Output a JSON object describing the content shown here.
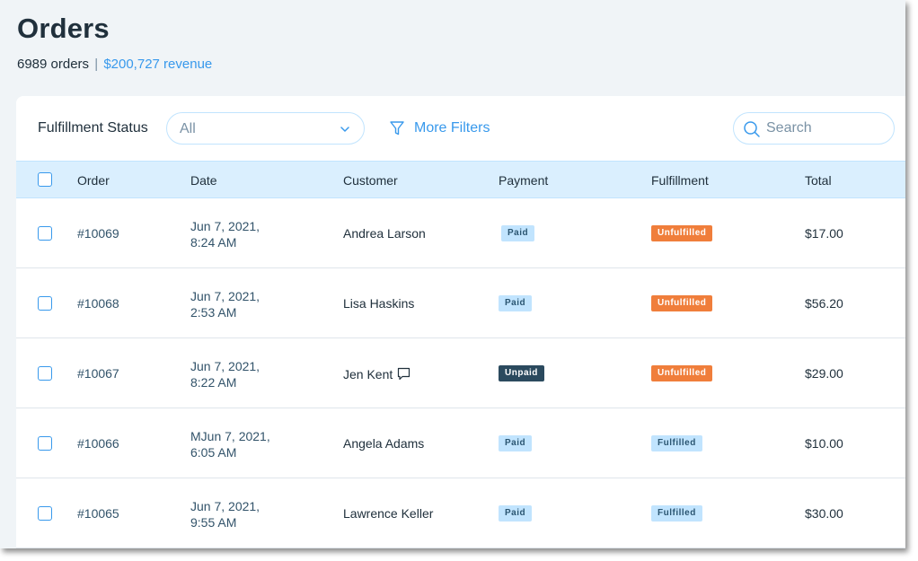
{
  "header": {
    "title": "Orders",
    "orders_count": "6989 orders",
    "separator": "|",
    "revenue": "$200,727 revenue"
  },
  "filters": {
    "fulfillment_label": "Fulfillment Status",
    "fulfillment_value": "All",
    "more_filters_label": "More Filters",
    "search_placeholder": "Search"
  },
  "table": {
    "columns": [
      "Order",
      "Date",
      "Customer",
      "Payment",
      "Fulfillment",
      "Total"
    ],
    "rows": [
      {
        "order": "#10069",
        "date_line1": "Jun 7, 2021,",
        "date_line2": "8:24 AM",
        "customer": "Andrea Larson",
        "payment": "Paid",
        "fulfillment": "Unfulfilled",
        "total": "$17.00",
        "has_note": false
      },
      {
        "order": "#10068",
        "date_line1": "Jun 7, 2021,",
        "date_line2": "2:53 AM",
        "customer": "Lisa Haskins",
        "payment": "Paid",
        "fulfillment": "Unfulfilled",
        "total": "$56.20",
        "has_note": false
      },
      {
        "order": "#10067",
        "date_line1": "Jun 7, 2021,",
        "date_line2": "8:22 AM",
        "customer": "Jen Kent",
        "payment": "Unpaid",
        "fulfillment": "Unfulfilled",
        "total": "$29.00",
        "has_note": true
      },
      {
        "order": "#10066",
        "date_line1": "MJun 7, 2021,",
        "date_line2": "6:05 AM",
        "customer": "Angela Adams",
        "payment": "Paid",
        "fulfillment": "Fulfilled",
        "total": "$10.00",
        "has_note": false
      },
      {
        "order": "#10065",
        "date_line1": "Jun 7, 2021,",
        "date_line2": "9:55 AM",
        "customer": "Lawrence Keller",
        "payment": "Paid",
        "fulfillment": "Fulfilled",
        "total": "$30.00",
        "has_note": false
      }
    ]
  },
  "colors": {
    "accent": "#3899ec",
    "header_bg": "#daeffe",
    "badge_paid": "#c1e4fe",
    "badge_unpaid": "#2b4a5e",
    "badge_unfulfilled": "#f07e3b",
    "badge_fulfilled": "#c1e4fe"
  },
  "icons": {
    "chevron": "chevron-down-icon",
    "filter": "filter-icon",
    "search": "search-icon",
    "note": "chat-bubble-icon"
  }
}
